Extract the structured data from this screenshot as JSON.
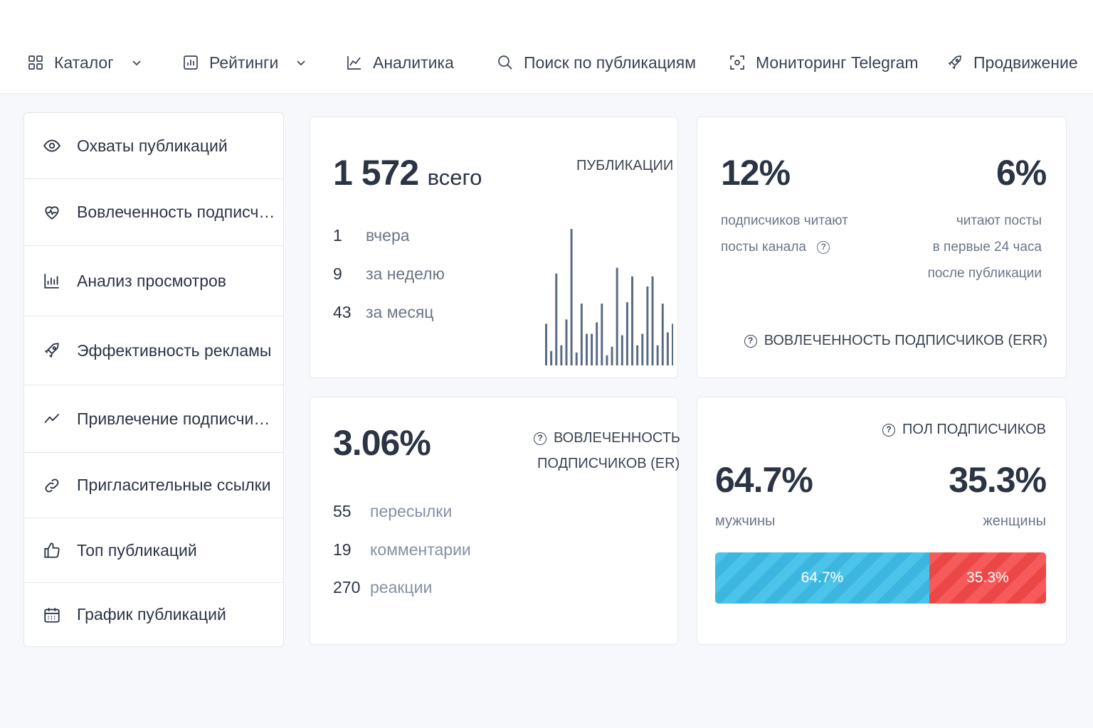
{
  "nav": {
    "items": [
      {
        "label": "Каталог",
        "icon": "grid-icon",
        "dropdown": true
      },
      {
        "label": "Рейтинги",
        "icon": "bar-chart-icon",
        "dropdown": true
      },
      {
        "label": "Аналитика",
        "icon": "line-chart-icon",
        "dropdown": false
      },
      {
        "label": "Поиск по публикациям",
        "icon": "search-icon",
        "dropdown": false
      },
      {
        "label": "Мониторинг Telegram",
        "icon": "scan-icon",
        "dropdown": false
      },
      {
        "label": "Продвижение",
        "icon": "rocket-icon",
        "dropdown": true
      }
    ]
  },
  "sidebar": {
    "items": [
      {
        "label": "Охваты публикаций",
        "icon": "eye-icon"
      },
      {
        "label": "Вовлеченность подписчик...",
        "icon": "heart-pulse-icon"
      },
      {
        "label": "Анализ просмотров",
        "icon": "bar-chart-icon"
      },
      {
        "label": "Эффективность рекламы",
        "icon": "rocket-icon"
      },
      {
        "label": "Привлечение подписчиков",
        "icon": "trend-line-icon"
      },
      {
        "label": "Пригласительные ссылки",
        "icon": "link-icon"
      },
      {
        "label": "Топ публикаций",
        "icon": "thumbs-up-icon"
      },
      {
        "label": "График публикаций",
        "icon": "calendar-icon"
      }
    ]
  },
  "publications": {
    "total": "1 572",
    "total_suffix": "всего",
    "caption": "ПУБЛИКАЦИИ",
    "stats": [
      {
        "value": "1",
        "label": "вчера"
      },
      {
        "value": "9",
        "label": "за неделю"
      },
      {
        "value": "43",
        "label": "за месяц"
      }
    ]
  },
  "err": {
    "left_value": "12%",
    "left_line1": "подписчиков читают",
    "left_line2": "посты канала",
    "right_value": "6%",
    "right_line1": "читают посты",
    "right_line2": "в первые 24 часа",
    "right_line3": "после публикации",
    "caption": "ВОВЛЕЧЕННОСТЬ ПОДПИСЧИКОВ (ERR)"
  },
  "er": {
    "value": "3.06%",
    "caption_line1": "ВОВЛЕЧЕННОСТЬ",
    "caption_line2": "ПОДПИСЧИКОВ (ER)",
    "stats": [
      {
        "value": "55",
        "label": "пересылки"
      },
      {
        "value": "19",
        "label": "комментарии"
      },
      {
        "value": "270",
        "label": "реакции"
      }
    ]
  },
  "gender": {
    "caption": "ПОЛ ПОДПИСЧИКОВ",
    "male_value": "64.7%",
    "male_label": "мужчины",
    "female_value": "35.3%",
    "female_label": "женщины",
    "male_fraction": 0.647,
    "colors": {
      "male": "#45bde5",
      "female": "#f05050"
    }
  },
  "chart_data": {
    "type": "bar",
    "values": [
      58,
      20,
      128,
      28,
      64,
      190,
      18,
      86,
      44,
      44,
      60,
      86,
      14,
      26,
      136,
      42,
      88,
      124,
      28,
      44,
      110,
      124,
      28,
      86,
      46,
      58
    ],
    "color": "#5a6b84"
  }
}
